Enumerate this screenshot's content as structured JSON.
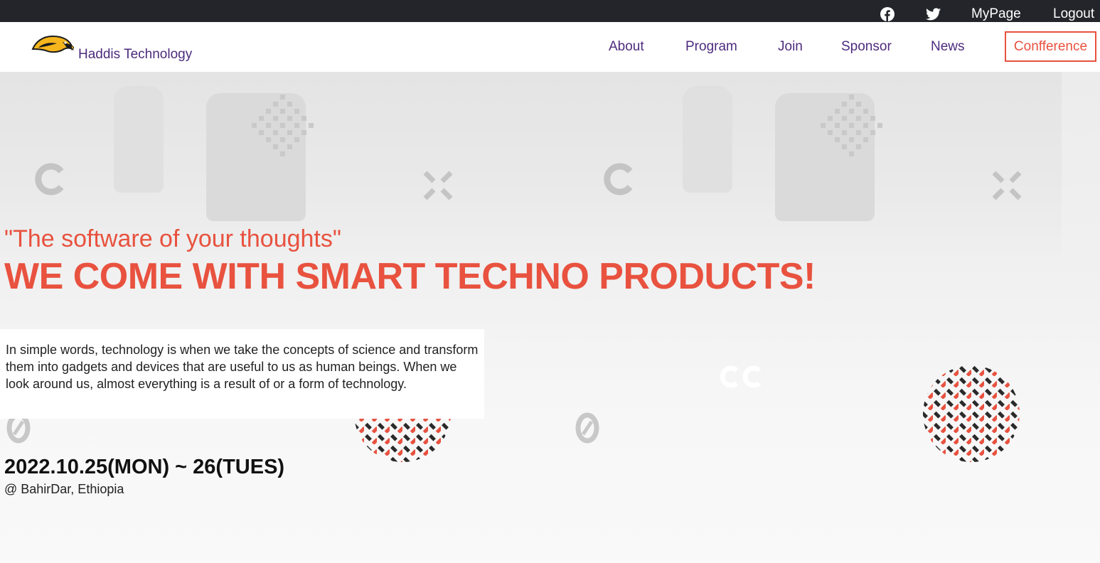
{
  "topbar": {
    "icons": [
      "facebook-icon",
      "twitter-icon"
    ],
    "mypage_label": "MyPage",
    "logout_label": "Logout"
  },
  "navbar": {
    "brand": "Haddis Technology",
    "logo_icon": "eagle-logo-icon",
    "items": [
      {
        "label": "About"
      },
      {
        "label": "Program"
      },
      {
        "label": "Join"
      },
      {
        "label": "Sponsor"
      },
      {
        "label": "News"
      },
      {
        "label": "Confference",
        "highlighted": true
      }
    ]
  },
  "hero": {
    "quote": "\"The software of your thoughts\"",
    "headline": "WE COME WITH SMART TECHNO PRODUCTS!",
    "description": "In simple words, technology is when we take the concepts of science and transform them into gadgets and devices that are useful to us as human beings. When we look around us, almost everything is a result of or a form of technology.",
    "date": "2022.10.25(MON) ~ 26(TUES)",
    "location": "@ BahirDar, Ethiopia"
  },
  "colors": {
    "accent": "#e8523f",
    "nav_text": "#4d2b7e",
    "topbar_bg": "#23252b"
  }
}
